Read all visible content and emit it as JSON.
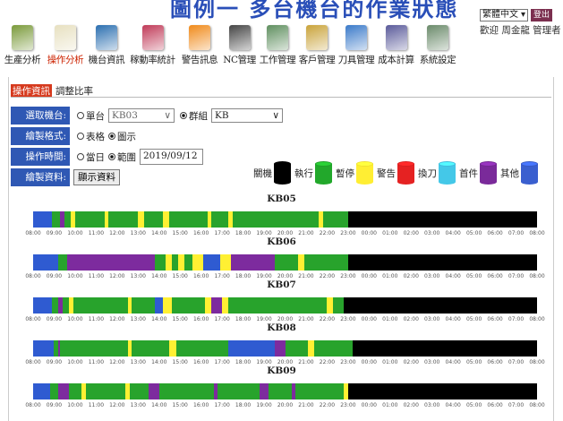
{
  "banner": {
    "title": "圖例一 多台機台的作業狀態"
  },
  "header": {
    "language": "繁體中文",
    "logout_label": "登出",
    "welcome": "歡迎 周金龍 管理者"
  },
  "nav": {
    "items": [
      {
        "label": "生產分析",
        "icon": "production-analysis-icon",
        "color": "#7a9a3a",
        "active": false
      },
      {
        "label": "操作分析",
        "icon": "operation-analysis-icon",
        "color": "#e7e0c0",
        "active": true
      },
      {
        "label": "機台資訊",
        "icon": "machine-info-icon",
        "color": "#2b6fb0",
        "active": false
      },
      {
        "label": "稼動率統計",
        "icon": "utilization-stats-icon",
        "color": "#c03a58",
        "active": false
      },
      {
        "label": "警告訊息",
        "icon": "warning-icon",
        "color": "#f08a1a",
        "active": false
      },
      {
        "label": "NC管理",
        "icon": "nc-management-icon",
        "color": "#444444",
        "active": false
      },
      {
        "label": "工作管理",
        "icon": "job-management-icon",
        "color": "#5f8f5f",
        "active": false
      },
      {
        "label": "客戶管理",
        "icon": "customer-management-icon",
        "color": "#c9a33a",
        "active": false
      },
      {
        "label": "刀具管理",
        "icon": "tool-management-icon",
        "color": "#3a7ac9",
        "active": false
      },
      {
        "label": "成本計算",
        "icon": "cost-calc-icon",
        "color": "#5a5a9a",
        "active": false
      },
      {
        "label": "系統設定",
        "icon": "system-settings-icon",
        "color": "#6a8a6a",
        "active": false
      }
    ]
  },
  "subtabs": {
    "active": "操作資訊",
    "other": "調整比率"
  },
  "form": {
    "machine_label": "選取機台:",
    "single_label": "單台",
    "machine_value": "KB03",
    "group_label": "群組",
    "group_value": "KB",
    "format_label": "繪製格式:",
    "table_label": "表格",
    "chart_label": "圖示",
    "time_label": "操作時間:",
    "day_label": "當日",
    "range_label": "範圍",
    "date_value": "2019/09/12",
    "draw_label": "繪製資料:",
    "show_button": "顯示資料"
  },
  "legend": [
    {
      "label": "關機",
      "color": "#000000"
    },
    {
      "label": "執行",
      "color": "#22a82b"
    },
    {
      "label": "暫停",
      "color": "#ffee33"
    },
    {
      "label": "警告",
      "color": "#e52222"
    },
    {
      "label": "換刀",
      "color": "#44c8e8"
    },
    {
      "label": "首件",
      "color": "#7a2a9a"
    },
    {
      "label": "其他",
      "color": "#3a5fcf"
    }
  ],
  "state_colors": {
    "run": "#28a32c",
    "stop": "#fff033",
    "off": "#000000",
    "first": "#7d2b9e",
    "other": "#2f5bd1",
    "alarm": "#e52222",
    "tool": "#44c8e8"
  },
  "time_ticks": [
    "08:00",
    "09:00",
    "10:00",
    "11:00",
    "12:00",
    "13:00",
    "14:00",
    "15:00",
    "16:00",
    "17:00",
    "18:00",
    "19:00",
    "20:00",
    "21:00",
    "22:00",
    "23:00",
    "00:00",
    "01:00",
    "02:00",
    "03:00",
    "04:00",
    "05:00",
    "06:00",
    "07:00",
    "08:00"
  ],
  "chart_data": {
    "type": "timeline",
    "x_unit": "hours from 08:00",
    "x_range": [
      0,
      24
    ],
    "machines": [
      {
        "name": "KB05",
        "segments": [
          [
            0,
            0.9,
            "other"
          ],
          [
            0.9,
            1.3,
            "run"
          ],
          [
            1.3,
            1.5,
            "first"
          ],
          [
            1.5,
            1.8,
            "run"
          ],
          [
            1.8,
            2.0,
            "stop"
          ],
          [
            2.0,
            3.4,
            "run"
          ],
          [
            3.4,
            3.6,
            "stop"
          ],
          [
            3.6,
            5.0,
            "run"
          ],
          [
            5.0,
            5.3,
            "stop"
          ],
          [
            5.3,
            6.2,
            "run"
          ],
          [
            6.2,
            6.5,
            "stop"
          ],
          [
            6.5,
            8.3,
            "run"
          ],
          [
            8.3,
            8.5,
            "stop"
          ],
          [
            8.5,
            9.3,
            "run"
          ],
          [
            9.3,
            9.5,
            "stop"
          ],
          [
            9.5,
            13.6,
            "run"
          ],
          [
            13.6,
            13.8,
            "stop"
          ],
          [
            13.8,
            15.0,
            "run"
          ],
          [
            15.0,
            24,
            "off"
          ]
        ]
      },
      {
        "name": "KB06",
        "segments": [
          [
            0,
            1.2,
            "other"
          ],
          [
            1.2,
            1.6,
            "run"
          ],
          [
            1.6,
            5.8,
            "first"
          ],
          [
            5.8,
            6.3,
            "run"
          ],
          [
            6.3,
            6.6,
            "stop"
          ],
          [
            6.6,
            6.9,
            "run"
          ],
          [
            6.9,
            7.2,
            "stop"
          ],
          [
            7.2,
            7.6,
            "run"
          ],
          [
            7.6,
            8.1,
            "stop"
          ],
          [
            8.1,
            8.9,
            "other"
          ],
          [
            8.9,
            9.4,
            "stop"
          ],
          [
            9.4,
            11.5,
            "first"
          ],
          [
            11.5,
            12.6,
            "run"
          ],
          [
            12.6,
            12.9,
            "stop"
          ],
          [
            12.9,
            15.0,
            "run"
          ],
          [
            15.0,
            24,
            "off"
          ]
        ]
      },
      {
        "name": "KB07",
        "segments": [
          [
            0,
            0.9,
            "other"
          ],
          [
            0.9,
            1.2,
            "run"
          ],
          [
            1.2,
            1.4,
            "first"
          ],
          [
            1.4,
            1.7,
            "run"
          ],
          [
            1.7,
            1.9,
            "stop"
          ],
          [
            1.9,
            4.5,
            "run"
          ],
          [
            4.5,
            4.7,
            "stop"
          ],
          [
            4.7,
            5.8,
            "run"
          ],
          [
            5.8,
            6.2,
            "other"
          ],
          [
            6.2,
            6.6,
            "stop"
          ],
          [
            6.6,
            8.2,
            "run"
          ],
          [
            8.2,
            8.5,
            "stop"
          ],
          [
            8.5,
            9.0,
            "first"
          ],
          [
            9.0,
            9.3,
            "stop"
          ],
          [
            9.3,
            14.0,
            "run"
          ],
          [
            14.0,
            14.3,
            "stop"
          ],
          [
            14.3,
            14.8,
            "run"
          ],
          [
            14.8,
            24,
            "off"
          ]
        ]
      },
      {
        "name": "KB08",
        "segments": [
          [
            0,
            1.0,
            "other"
          ],
          [
            1.0,
            1.2,
            "run"
          ],
          [
            1.2,
            1.3,
            "first"
          ],
          [
            1.3,
            4.5,
            "run"
          ],
          [
            4.5,
            4.7,
            "stop"
          ],
          [
            4.7,
            6.5,
            "run"
          ],
          [
            6.5,
            6.8,
            "stop"
          ],
          [
            6.8,
            9.3,
            "run"
          ],
          [
            9.3,
            11.5,
            "other"
          ],
          [
            11.5,
            12.0,
            "first"
          ],
          [
            12.0,
            13.1,
            "run"
          ],
          [
            13.1,
            13.4,
            "stop"
          ],
          [
            13.4,
            15.2,
            "run"
          ],
          [
            15.2,
            24,
            "off"
          ]
        ]
      },
      {
        "name": "KB09",
        "segments": [
          [
            0,
            0.8,
            "other"
          ],
          [
            0.8,
            1.2,
            "run"
          ],
          [
            1.2,
            1.7,
            "first"
          ],
          [
            1.7,
            2.3,
            "run"
          ],
          [
            2.3,
            2.5,
            "stop"
          ],
          [
            2.5,
            4.4,
            "run"
          ],
          [
            4.4,
            4.6,
            "stop"
          ],
          [
            4.6,
            5.5,
            "run"
          ],
          [
            5.5,
            6.0,
            "first"
          ],
          [
            6.0,
            8.6,
            "run"
          ],
          [
            8.6,
            8.8,
            "first"
          ],
          [
            8.8,
            10.8,
            "run"
          ],
          [
            10.8,
            11.2,
            "first"
          ],
          [
            11.2,
            12.3,
            "run"
          ],
          [
            12.3,
            12.5,
            "first"
          ],
          [
            12.5,
            14.8,
            "run"
          ],
          [
            14.8,
            15.0,
            "stop"
          ],
          [
            15.0,
            24,
            "off"
          ]
        ]
      }
    ]
  }
}
